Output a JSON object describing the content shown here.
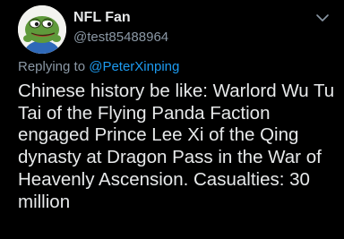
{
  "user": {
    "display_name": "NFL Fan",
    "handle": "@test85488964",
    "avatar_icon": "pepe-frog-avatar"
  },
  "more_icon": "chevron-down-icon",
  "reply_context": {
    "prefix": "Replying to",
    "mention": "@PeterXinping"
  },
  "tweet": {
    "lines": [
      "Chinese history be like: Warlord Wu Tu",
      "Tai of the Flying Panda Faction",
      "engaged Prince Lee Xi of the Qing",
      "dynasty at Dragon Pass in the War of",
      "Heavenly Ascension. Casualties: 30",
      "million"
    ]
  },
  "colors": {
    "background": "#000000",
    "text": "#e7e9ea",
    "secondary": "#8b98a5",
    "link": "#1d9bf0"
  }
}
